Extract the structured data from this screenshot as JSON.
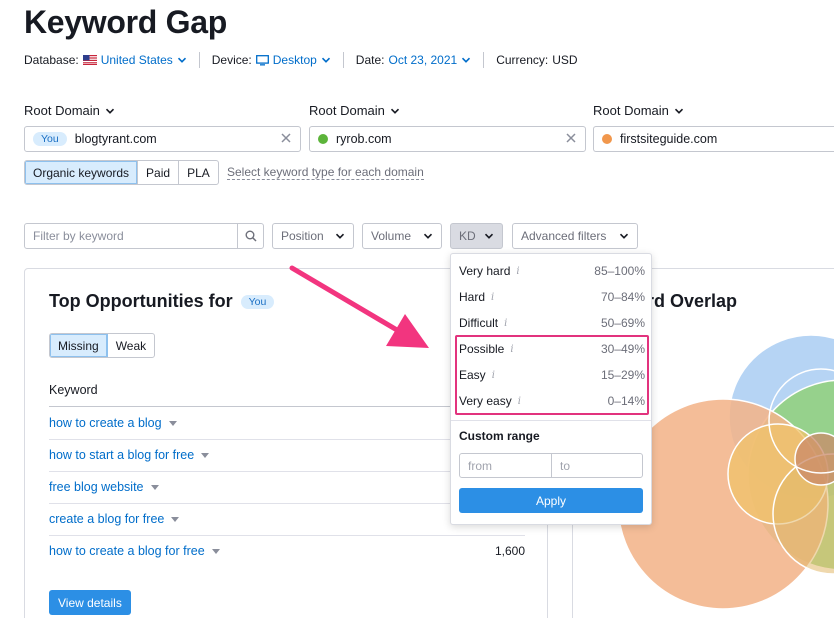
{
  "page_title": "Keyword Gap",
  "meta": {
    "database_label": "Database:",
    "database_value": "United States",
    "device_label": "Device:",
    "device_value": "Desktop",
    "date_label": "Date:",
    "date_value": "Oct 23, 2021",
    "currency_label": "Currency:",
    "currency_value": "USD"
  },
  "domains": [
    {
      "label": "Root Domain",
      "value": "blogtyrant.com",
      "badge": "You"
    },
    {
      "label": "Root Domain",
      "value": "ryrob.com",
      "dot_color": "#5cb43a"
    },
    {
      "label": "Root Domain",
      "value": "firstsiteguide.com",
      "dot_color": "#f1974c"
    }
  ],
  "keyword_types": [
    "Organic keywords",
    "Paid",
    "PLA"
  ],
  "keyword_type_link": "Select keyword type for each domain",
  "filters": {
    "search_placeholder": "Filter by keyword",
    "position": "Position",
    "volume": "Volume",
    "kd": "KD",
    "advanced": "Advanced filters"
  },
  "opportunities": {
    "title": "Top Opportunities for",
    "badge": "You",
    "tabs": [
      "Missing",
      "Weak"
    ],
    "column_header": "Keyword",
    "rows": [
      {
        "keyword": "how to create a blog",
        "volume": ""
      },
      {
        "keyword": "how to start a blog for free",
        "volume": ""
      },
      {
        "keyword": "free blog website",
        "volume": ""
      },
      {
        "keyword": "create a blog for free",
        "volume": ""
      },
      {
        "keyword": "how to create a blog for free",
        "volume": "1,600"
      }
    ],
    "view_button": "View details"
  },
  "overlap_title": "rd Overlap",
  "kd_menu": {
    "items": [
      {
        "name": "Very hard",
        "range": "85–100%"
      },
      {
        "name": "Hard",
        "range": "70–84%"
      },
      {
        "name": "Difficult",
        "range": "50–69%"
      },
      {
        "name": "Possible",
        "range": "30–49%"
      },
      {
        "name": "Easy",
        "range": "15–29%"
      },
      {
        "name": "Very easy",
        "range": "0–14%"
      }
    ],
    "info_glyph": "i",
    "custom_label": "Custom range",
    "from_placeholder": "from",
    "to_placeholder": "to",
    "apply": "Apply"
  },
  "colors": {
    "accent": "#2c8fe5",
    "link": "#006dca",
    "highlight": "#e2337e",
    "arrow": "#f2357f"
  }
}
